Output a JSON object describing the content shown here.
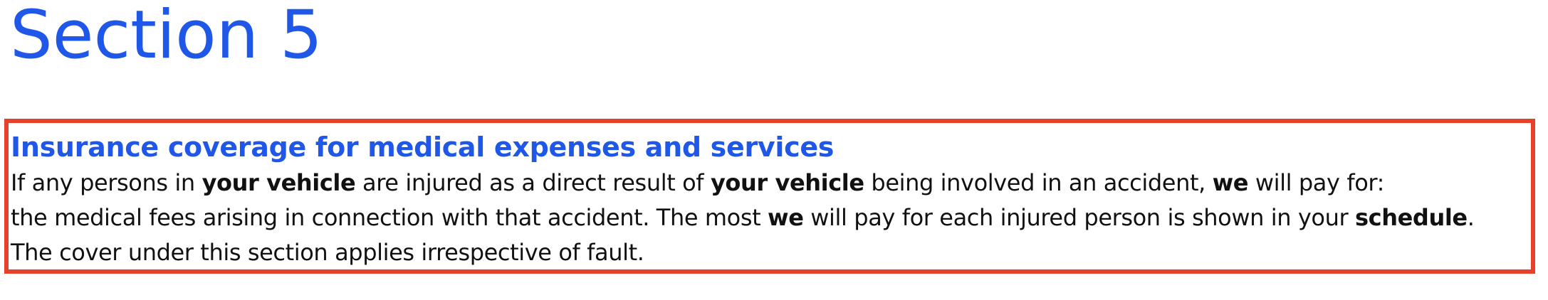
{
  "page": {
    "title": "Section 5"
  },
  "section": {
    "heading": "Insurance coverage for medical expenses and services",
    "line1": {
      "t1": "If any persons in ",
      "b1": "your vehicle",
      "t2": " are injured as a direct result of ",
      "b2": "your vehicle",
      "t3": " being involved in an accident, ",
      "b3": "we",
      "t4": " will pay for:"
    },
    "line2": {
      "t1": "the medical fees arising in connection with that accident. The most ",
      "b1": "we",
      "t2": " will pay for each injured person is shown in your ",
      "b2": "schedule",
      "t3": "."
    },
    "line3": {
      "t1": "The cover under this section applies irrespective of fault."
    }
  },
  "colors": {
    "title": "#1f57e8",
    "heading": "#1f57e8",
    "highlight_border": "#e7402b",
    "text": "#111111"
  }
}
